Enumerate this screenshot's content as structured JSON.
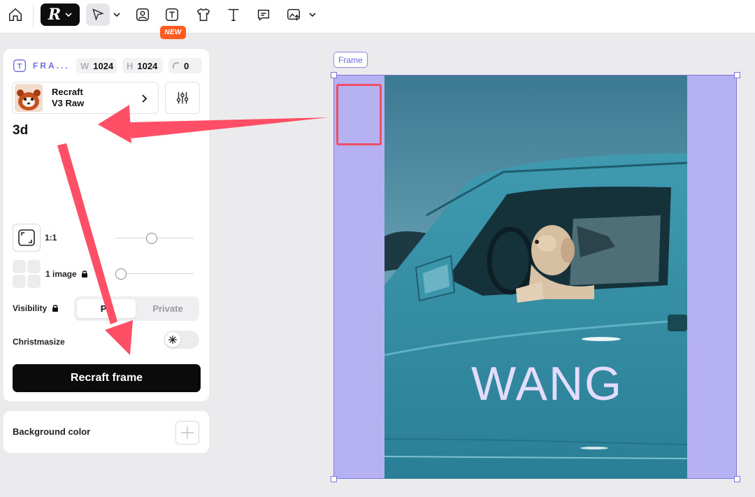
{
  "toolbar": {
    "new_badge": "NEW"
  },
  "panel": {
    "frame_label": "FRA...",
    "width_key": "W",
    "width_value": "1024",
    "height_key": "H",
    "height_value": "1024",
    "radius_value": "0",
    "model_name_line1": "Recraft",
    "model_name_line2": "V3 Raw",
    "prompt": "3d",
    "ratio_label": "1:1",
    "images_label": "1 image",
    "visibility_label": "Visibility",
    "visibility_options": [
      "Public",
      "Private"
    ],
    "visibility_active_shown": "Pu",
    "christmasize_label": "Christmasize",
    "action_button": "Recraft frame",
    "background_label": "Background color"
  },
  "canvas": {
    "frame_tag": "Frame",
    "overlay_text": "WANG"
  },
  "colors": {
    "accent": "#6f6be0",
    "frame_fill": "#b6b1f0",
    "annotation_red": "#f04e64",
    "new_badge": "#ff5a1f"
  }
}
